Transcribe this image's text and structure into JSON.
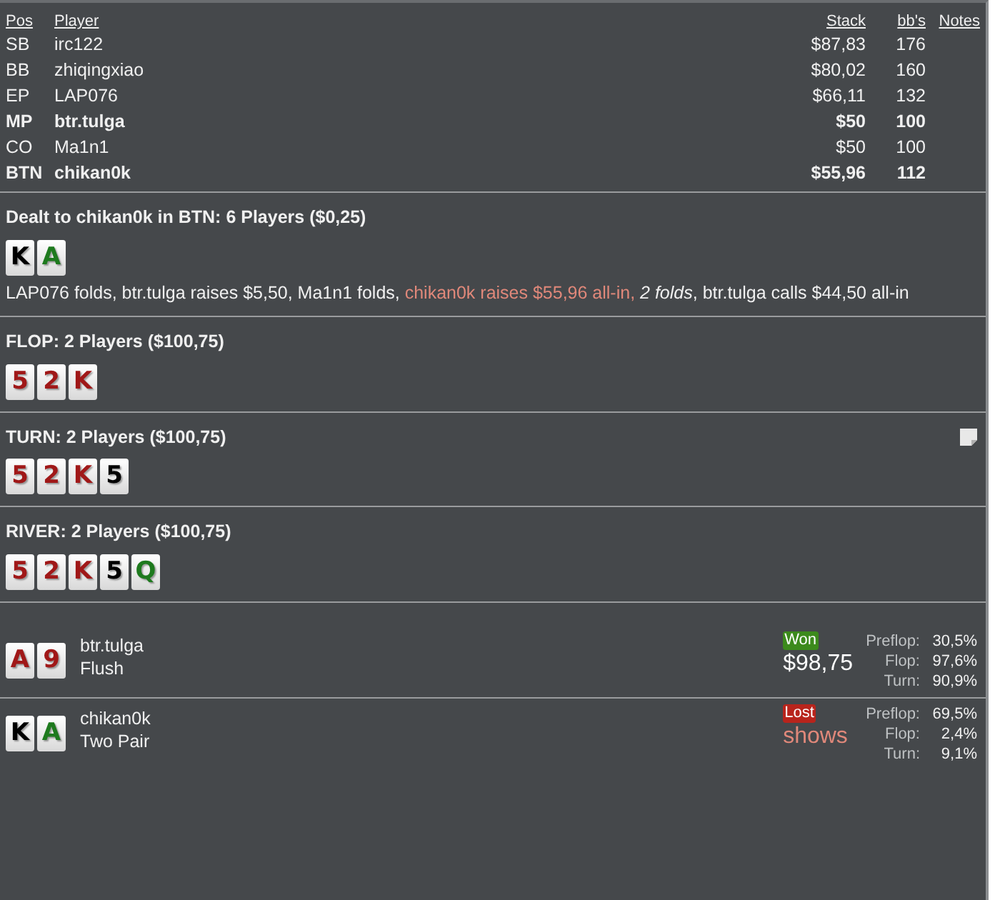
{
  "table": {
    "columns": [
      "Pos",
      "Player",
      "Stack",
      "bb's",
      "Notes"
    ],
    "rows": [
      {
        "pos": "SB",
        "player": "irc122",
        "stack": "$87,83",
        "bbs": "176",
        "in_hand": false
      },
      {
        "pos": "BB",
        "player": "zhiqingxiao",
        "stack": "$80,02",
        "bbs": "160",
        "in_hand": false
      },
      {
        "pos": "EP",
        "player": "LAP076",
        "stack": "$66,11",
        "bbs": "132",
        "in_hand": false
      },
      {
        "pos": "MP",
        "player": "btr.tulga",
        "stack": "$50",
        "bbs": "100",
        "in_hand": true
      },
      {
        "pos": "CO",
        "player": "Ma1n1",
        "stack": "$50",
        "bbs": "100",
        "in_hand": false
      },
      {
        "pos": "BTN",
        "player": "chikan0k",
        "stack": "$55,96",
        "bbs": "112",
        "in_hand": true
      }
    ]
  },
  "streets": [
    {
      "title": "Dealt to chikan0k in BTN: 6 Players ($0,25)",
      "note": false,
      "cards": [
        {
          "rank": "K",
          "color": "#000000"
        },
        {
          "rank": "A",
          "color": "#1e7a1e"
        }
      ],
      "actions": [
        {
          "kind": "plain",
          "text": "LAP076 folds, btr.tulga raises $5,50, Ma1n1 folds,"
        },
        {
          "kind": "hero",
          "text": "chikan0k raises $55,96 all-in,"
        },
        {
          "kind": "folds",
          "text": "2 folds"
        },
        {
          "kind": "plain",
          "text": ", btr.tulga calls $44,50 all-in"
        }
      ]
    },
    {
      "title": "FLOP: 2 Players ($100,75)",
      "note": false,
      "cards": [
        {
          "rank": "5",
          "color": "#a01818"
        },
        {
          "rank": "2",
          "color": "#a01818"
        },
        {
          "rank": "K",
          "color": "#a01818"
        }
      ]
    },
    {
      "title": "TURN: 2 Players ($100,75)",
      "note": true,
      "cards": [
        {
          "rank": "5",
          "color": "#a01818"
        },
        {
          "rank": "2",
          "color": "#a01818"
        },
        {
          "rank": "K",
          "color": "#a01818"
        },
        {
          "rank": "5",
          "color": "#000000"
        }
      ]
    },
    {
      "title": "RIVER: 2 Players ($100,75)",
      "note": false,
      "cards": [
        {
          "rank": "5",
          "color": "#a01818"
        },
        {
          "rank": "2",
          "color": "#a01818"
        },
        {
          "rank": "K",
          "color": "#a01818"
        },
        {
          "rank": "5",
          "color": "#000000"
        },
        {
          "rank": "Q",
          "color": "#1e7a1e"
        }
      ]
    }
  ],
  "results": [
    {
      "player": "btr.tulga",
      "hand": "Flush",
      "cards": [
        {
          "rank": "A",
          "color": "#a01818"
        },
        {
          "rank": "9",
          "color": "#a01818"
        }
      ],
      "kind": "won",
      "badge": "Won",
      "amount": "$98,75",
      "equity": [
        {
          "label": "Preflop:",
          "value": "30,5%"
        },
        {
          "label": "Flop:",
          "value": "97,6%"
        },
        {
          "label": "Turn:",
          "value": "90,9%"
        }
      ]
    },
    {
      "player": "chikan0k",
      "hand": "Two Pair",
      "cards": [
        {
          "rank": "K",
          "color": "#000000"
        },
        {
          "rank": "A",
          "color": "#1e7a1e"
        }
      ],
      "kind": "lost",
      "badge": "Lost",
      "amount": "shows",
      "equity": [
        {
          "label": "Preflop:",
          "value": "69,5%"
        },
        {
          "label": "Flop:",
          "value": "2,4%"
        },
        {
          "label": "Turn:",
          "value": "9,1%"
        }
      ]
    }
  ]
}
